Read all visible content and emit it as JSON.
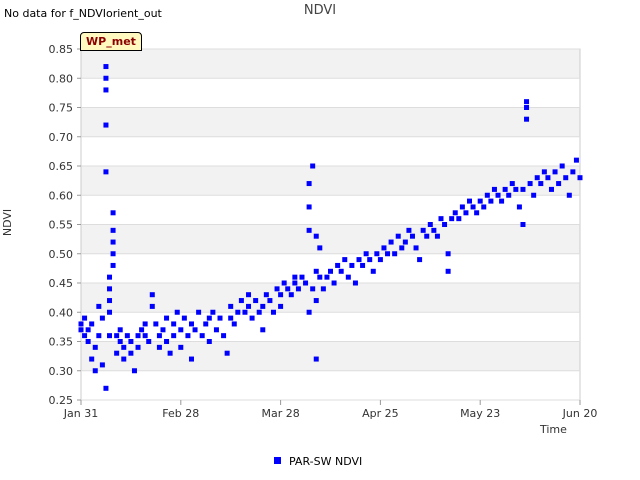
{
  "note": "No data for f_NDVIorient_out",
  "badge": "WP_met",
  "chart_data": {
    "type": "scatter",
    "title": "NDVI",
    "xlabel": "Time",
    "ylabel": "NDVI",
    "x_range": [
      "Jan 31",
      "Jun 20"
    ],
    "ylim": [
      0.25,
      0.85
    ],
    "x_ticks": [
      "Jan 31",
      "Feb 28",
      "Mar 28",
      "Apr 25",
      "May 23",
      "Jun 20"
    ],
    "y_ticks": [
      "0.25",
      "0.30",
      "0.35",
      "0.40",
      "0.45",
      "0.50",
      "0.55",
      "0.60",
      "0.65",
      "0.70",
      "0.75",
      "0.80",
      "0.85"
    ],
    "grid": "alternating horizontal bands",
    "legend_position": "bottom-center",
    "series_color": "#0000ff",
    "series": [
      {
        "name": "PAR-SW NDVI",
        "points": [
          [
            "Jan 31",
            0.37
          ],
          [
            "Jan 31",
            0.38
          ],
          [
            "Feb 1",
            0.36
          ],
          [
            "Feb 1",
            0.39
          ],
          [
            "Feb 2",
            0.35
          ],
          [
            "Feb 2",
            0.37
          ],
          [
            "Feb 3",
            0.38
          ],
          [
            "Feb 3",
            0.32
          ],
          [
            "Feb 4",
            0.3
          ],
          [
            "Feb 4",
            0.34
          ],
          [
            "Feb 5",
            0.36
          ],
          [
            "Feb 5",
            0.41
          ],
          [
            "Feb 6",
            0.39
          ],
          [
            "Feb 6",
            0.31
          ],
          [
            "Feb 7",
            0.82
          ],
          [
            "Feb 7",
            0.8
          ],
          [
            "Feb 7",
            0.78
          ],
          [
            "Feb 7",
            0.72
          ],
          [
            "Feb 7",
            0.64
          ],
          [
            "Feb 7",
            0.27
          ],
          [
            "Feb 8",
            0.46
          ],
          [
            "Feb 8",
            0.44
          ],
          [
            "Feb 8",
            0.42
          ],
          [
            "Feb 8",
            0.4
          ],
          [
            "Feb 8",
            0.36
          ],
          [
            "Feb 9",
            0.57
          ],
          [
            "Feb 9",
            0.54
          ],
          [
            "Feb 9",
            0.52
          ],
          [
            "Feb 9",
            0.5
          ],
          [
            "Feb 9",
            0.48
          ],
          [
            "Feb 10",
            0.36
          ],
          [
            "Feb 10",
            0.33
          ],
          [
            "Feb 11",
            0.35
          ],
          [
            "Feb 11",
            0.37
          ],
          [
            "Feb 12",
            0.34
          ],
          [
            "Feb 12",
            0.32
          ],
          [
            "Feb 13",
            0.36
          ],
          [
            "Feb 14",
            0.35
          ],
          [
            "Feb 14",
            0.33
          ],
          [
            "Feb 15",
            0.3
          ],
          [
            "Feb 16",
            0.36
          ],
          [
            "Feb 16",
            0.34
          ],
          [
            "Feb 17",
            0.37
          ],
          [
            "Feb 18",
            0.36
          ],
          [
            "Feb 18",
            0.38
          ],
          [
            "Feb 19",
            0.35
          ],
          [
            "Feb 20",
            0.43
          ],
          [
            "Feb 20",
            0.41
          ],
          [
            "Feb 21",
            0.38
          ],
          [
            "Feb 22",
            0.34
          ],
          [
            "Feb 22",
            0.36
          ],
          [
            "Feb 23",
            0.37
          ],
          [
            "Feb 24",
            0.39
          ],
          [
            "Feb 24",
            0.35
          ],
          [
            "Feb 25",
            0.33
          ],
          [
            "Feb 26",
            0.38
          ],
          [
            "Feb 26",
            0.36
          ],
          [
            "Feb 27",
            0.4
          ],
          [
            "Feb 28",
            0.37
          ],
          [
            "Feb 28",
            0.34
          ],
          [
            "Mar 1",
            0.39
          ],
          [
            "Mar 2",
            0.36
          ],
          [
            "Mar 3",
            0.32
          ],
          [
            "Mar 3",
            0.38
          ],
          [
            "Mar 4",
            0.37
          ],
          [
            "Mar 5",
            0.4
          ],
          [
            "Mar 6",
            0.36
          ],
          [
            "Mar 7",
            0.38
          ],
          [
            "Mar 8",
            0.39
          ],
          [
            "Mar 8",
            0.35
          ],
          [
            "Mar 9",
            0.4
          ],
          [
            "Mar 10",
            0.37
          ],
          [
            "Mar 11",
            0.39
          ],
          [
            "Mar 12",
            0.36
          ],
          [
            "Mar 13",
            0.33
          ],
          [
            "Mar 14",
            0.41
          ],
          [
            "Mar 14",
            0.39
          ],
          [
            "Mar 15",
            0.38
          ],
          [
            "Mar 16",
            0.4
          ],
          [
            "Mar 17",
            0.42
          ],
          [
            "Mar 18",
            0.4
          ],
          [
            "Mar 19",
            0.43
          ],
          [
            "Mar 19",
            0.41
          ],
          [
            "Mar 20",
            0.39
          ],
          [
            "Mar 21",
            0.42
          ],
          [
            "Mar 22",
            0.4
          ],
          [
            "Mar 23",
            0.37
          ],
          [
            "Mar 23",
            0.41
          ],
          [
            "Mar 24",
            0.43
          ],
          [
            "Mar 25",
            0.42
          ],
          [
            "Mar 26",
            0.4
          ],
          [
            "Mar 27",
            0.44
          ],
          [
            "Mar 28",
            0.43
          ],
          [
            "Mar 28",
            0.41
          ],
          [
            "Mar 29",
            0.45
          ],
          [
            "Mar 30",
            0.44
          ],
          [
            "Mar 31",
            0.43
          ],
          [
            "Apr 1",
            0.45
          ],
          [
            "Apr 1",
            0.46
          ],
          [
            "Apr 2",
            0.44
          ],
          [
            "Apr 3",
            0.46
          ],
          [
            "Apr 4",
            0.45
          ],
          [
            "Apr 5",
            0.62
          ],
          [
            "Apr 5",
            0.58
          ],
          [
            "Apr 5",
            0.54
          ],
          [
            "Apr 5",
            0.4
          ],
          [
            "Apr 6",
            0.44
          ],
          [
            "Apr 6",
            0.65
          ],
          [
            "Apr 7",
            0.53
          ],
          [
            "Apr 7",
            0.47
          ],
          [
            "Apr 7",
            0.42
          ],
          [
            "Apr 7",
            0.32
          ],
          [
            "Apr 8",
            0.51
          ],
          [
            "Apr 8",
            0.46
          ],
          [
            "Apr 9",
            0.44
          ],
          [
            "Apr 10",
            0.46
          ],
          [
            "Apr 11",
            0.47
          ],
          [
            "Apr 12",
            0.45
          ],
          [
            "Apr 13",
            0.48
          ],
          [
            "Apr 14",
            0.47
          ],
          [
            "Apr 15",
            0.49
          ],
          [
            "Apr 16",
            0.46
          ],
          [
            "Apr 17",
            0.48
          ],
          [
            "Apr 18",
            0.45
          ],
          [
            "Apr 19",
            0.49
          ],
          [
            "Apr 20",
            0.48
          ],
          [
            "Apr 21",
            0.5
          ],
          [
            "Apr 22",
            0.49
          ],
          [
            "Apr 23",
            0.47
          ],
          [
            "Apr 24",
            0.5
          ],
          [
            "Apr 25",
            0.49
          ],
          [
            "Apr 26",
            0.51
          ],
          [
            "Apr 27",
            0.5
          ],
          [
            "Apr 28",
            0.52
          ],
          [
            "Apr 29",
            0.5
          ],
          [
            "Apr 30",
            0.53
          ],
          [
            "May 1",
            0.51
          ],
          [
            "May 2",
            0.52
          ],
          [
            "May 3",
            0.54
          ],
          [
            "May 4",
            0.53
          ],
          [
            "May 5",
            0.51
          ],
          [
            "May 6",
            0.49
          ],
          [
            "May 7",
            0.54
          ],
          [
            "May 8",
            0.53
          ],
          [
            "May 9",
            0.55
          ],
          [
            "May 10",
            0.54
          ],
          [
            "May 11",
            0.53
          ],
          [
            "May 12",
            0.56
          ],
          [
            "May 13",
            0.55
          ],
          [
            "May 14",
            0.5
          ],
          [
            "May 14",
            0.47
          ],
          [
            "May 15",
            0.56
          ],
          [
            "May 16",
            0.57
          ],
          [
            "May 17",
            0.56
          ],
          [
            "May 18",
            0.58
          ],
          [
            "May 19",
            0.57
          ],
          [
            "May 20",
            0.59
          ],
          [
            "May 21",
            0.58
          ],
          [
            "May 22",
            0.57
          ],
          [
            "May 23",
            0.59
          ],
          [
            "May 24",
            0.58
          ],
          [
            "May 25",
            0.6
          ],
          [
            "May 26",
            0.59
          ],
          [
            "May 27",
            0.61
          ],
          [
            "May 28",
            0.6
          ],
          [
            "May 29",
            0.59
          ],
          [
            "May 30",
            0.61
          ],
          [
            "May 31",
            0.6
          ],
          [
            "Jun 1",
            0.62
          ],
          [
            "Jun 2",
            0.61
          ],
          [
            "Jun 3",
            0.58
          ],
          [
            "Jun 4",
            0.55
          ],
          [
            "Jun 4",
            0.61
          ],
          [
            "Jun 5",
            0.76
          ],
          [
            "Jun 5",
            0.75
          ],
          [
            "Jun 5",
            0.73
          ],
          [
            "Jun 6",
            0.62
          ],
          [
            "Jun 7",
            0.6
          ],
          [
            "Jun 8",
            0.63
          ],
          [
            "Jun 9",
            0.62
          ],
          [
            "Jun 10",
            0.64
          ],
          [
            "Jun 11",
            0.63
          ],
          [
            "Jun 12",
            0.61
          ],
          [
            "Jun 13",
            0.64
          ],
          [
            "Jun 14",
            0.62
          ],
          [
            "Jun 15",
            0.65
          ],
          [
            "Jun 16",
            0.63
          ],
          [
            "Jun 17",
            0.6
          ],
          [
            "Jun 18",
            0.64
          ],
          [
            "Jun 19",
            0.66
          ],
          [
            "Jun 20",
            0.63
          ]
        ]
      }
    ]
  }
}
